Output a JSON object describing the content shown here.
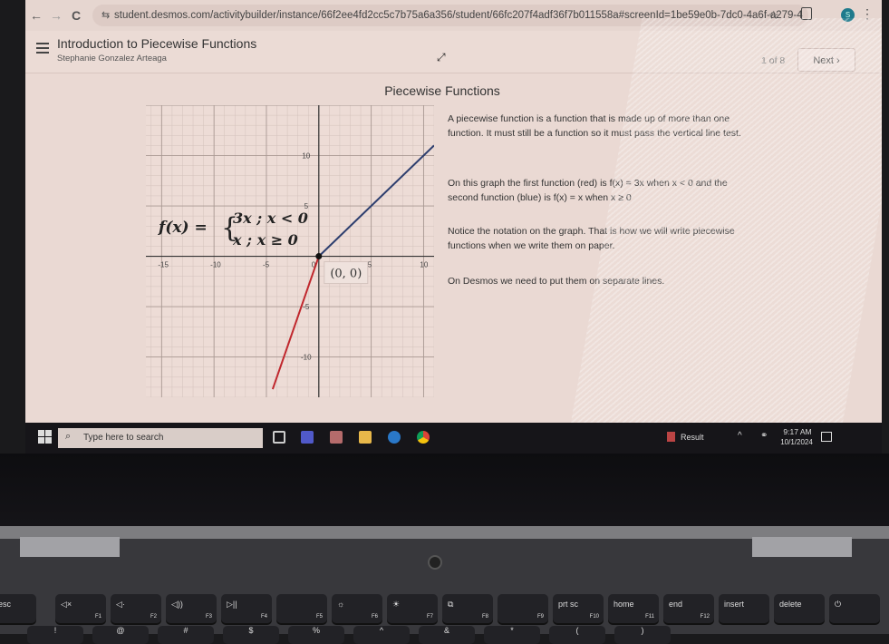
{
  "browser": {
    "back_icon": "←",
    "forward_icon": "→",
    "reload_icon": "C",
    "url": "student.desmos.com/activitybuilder/instance/66f2ee4fd2cc5c7b75a6a356/student/66fc207f4adf36f7b011558a#screenId=1be59e0b-7dc0-4a6f-a279-4",
    "site_info_icon": "⇆",
    "bookmark_icon": "☆",
    "profile_initial": "S",
    "menu_icon": "⋮"
  },
  "desmos": {
    "activity_title": "Introduction to Piecewise Functions",
    "student_name": "Stephanie Gonzalez Arteaga",
    "expand_icon": "⤢",
    "page_count": "1 of 8",
    "next_label": "Next ›",
    "screen_title": "Piecewise Functions",
    "paragraphs": [
      "A piecewise function is a function that is made up of more than one function. It must still be a function so it must pass the vertical line test.",
      "On this graph the first function (red) is f(x) = 3x when x < 0 and the second function (blue) is f(x) = x when x ≥ 0",
      "Notice the notation on the graph. That is how we will write piecewise functions when we write them on paper.",
      "On Desmos we need to put them on separate lines."
    ]
  },
  "chart_data": {
    "type": "line",
    "title": "",
    "xlabel": "",
    "ylabel": "",
    "xlim": [
      -16.5,
      11
    ],
    "ylim": [
      -14,
      15
    ],
    "x_ticks": [
      -15,
      -10,
      -5,
      0,
      5,
      10
    ],
    "y_ticks": [
      -10,
      -5,
      5,
      10
    ],
    "x_tick_labels": [
      "-15",
      "-10",
      "-5",
      "0",
      "5",
      "10"
    ],
    "y_tick_labels": [
      "-10",
      "-5",
      "5",
      "10"
    ],
    "grid": true,
    "series": [
      {
        "name": "3x ; x < 0",
        "color": "#c0272d",
        "points": [
          [
            -4.4,
            -13.2
          ],
          [
            0,
            0
          ]
        ]
      },
      {
        "name": "x ; x ≥ 0",
        "color": "#2d3e6e",
        "points": [
          [
            0,
            0
          ],
          [
            11,
            11
          ]
        ]
      }
    ],
    "point": {
      "x": 0,
      "y": 0,
      "label": "(0, 0)"
    },
    "annotation": {
      "lhs": "f(x) =",
      "case1": "3x ; x < 0",
      "case2": "x ; x ≥ 0"
    }
  },
  "taskbar": {
    "search_placeholder": "Type here to search",
    "search_icon": "⌕",
    "tray_app_label": "Result",
    "tray_chevron": "^",
    "time": "9:17 AM",
    "date": "10/1/2024"
  },
  "keyboard": {
    "keys": [
      {
        "label": "esc",
        "fn": ""
      },
      {
        "label": "◁×",
        "fn": "F1"
      },
      {
        "label": "◁·",
        "fn": "F2"
      },
      {
        "label": "◁))",
        "fn": "F3"
      },
      {
        "label": "▷||",
        "fn": "F4"
      },
      {
        "label": "",
        "fn": "F5"
      },
      {
        "label": "☼",
        "fn": "F6"
      },
      {
        "label": "☀",
        "fn": "F7"
      },
      {
        "label": "⧉",
        "fn": "F8"
      },
      {
        "label": "",
        "fn": "F9"
      },
      {
        "label": "prt sc",
        "fn": "F10"
      },
      {
        "label": "home",
        "fn": "F11"
      },
      {
        "label": "end",
        "fn": "F12"
      },
      {
        "label": "insert",
        "fn": ""
      },
      {
        "label": "delete",
        "fn": ""
      },
      {
        "label": "⏻",
        "fn": ""
      }
    ],
    "number_row": [
      "!",
      "@",
      "#",
      "$",
      "%",
      "^",
      "&",
      "*",
      "(",
      ")"
    ]
  }
}
